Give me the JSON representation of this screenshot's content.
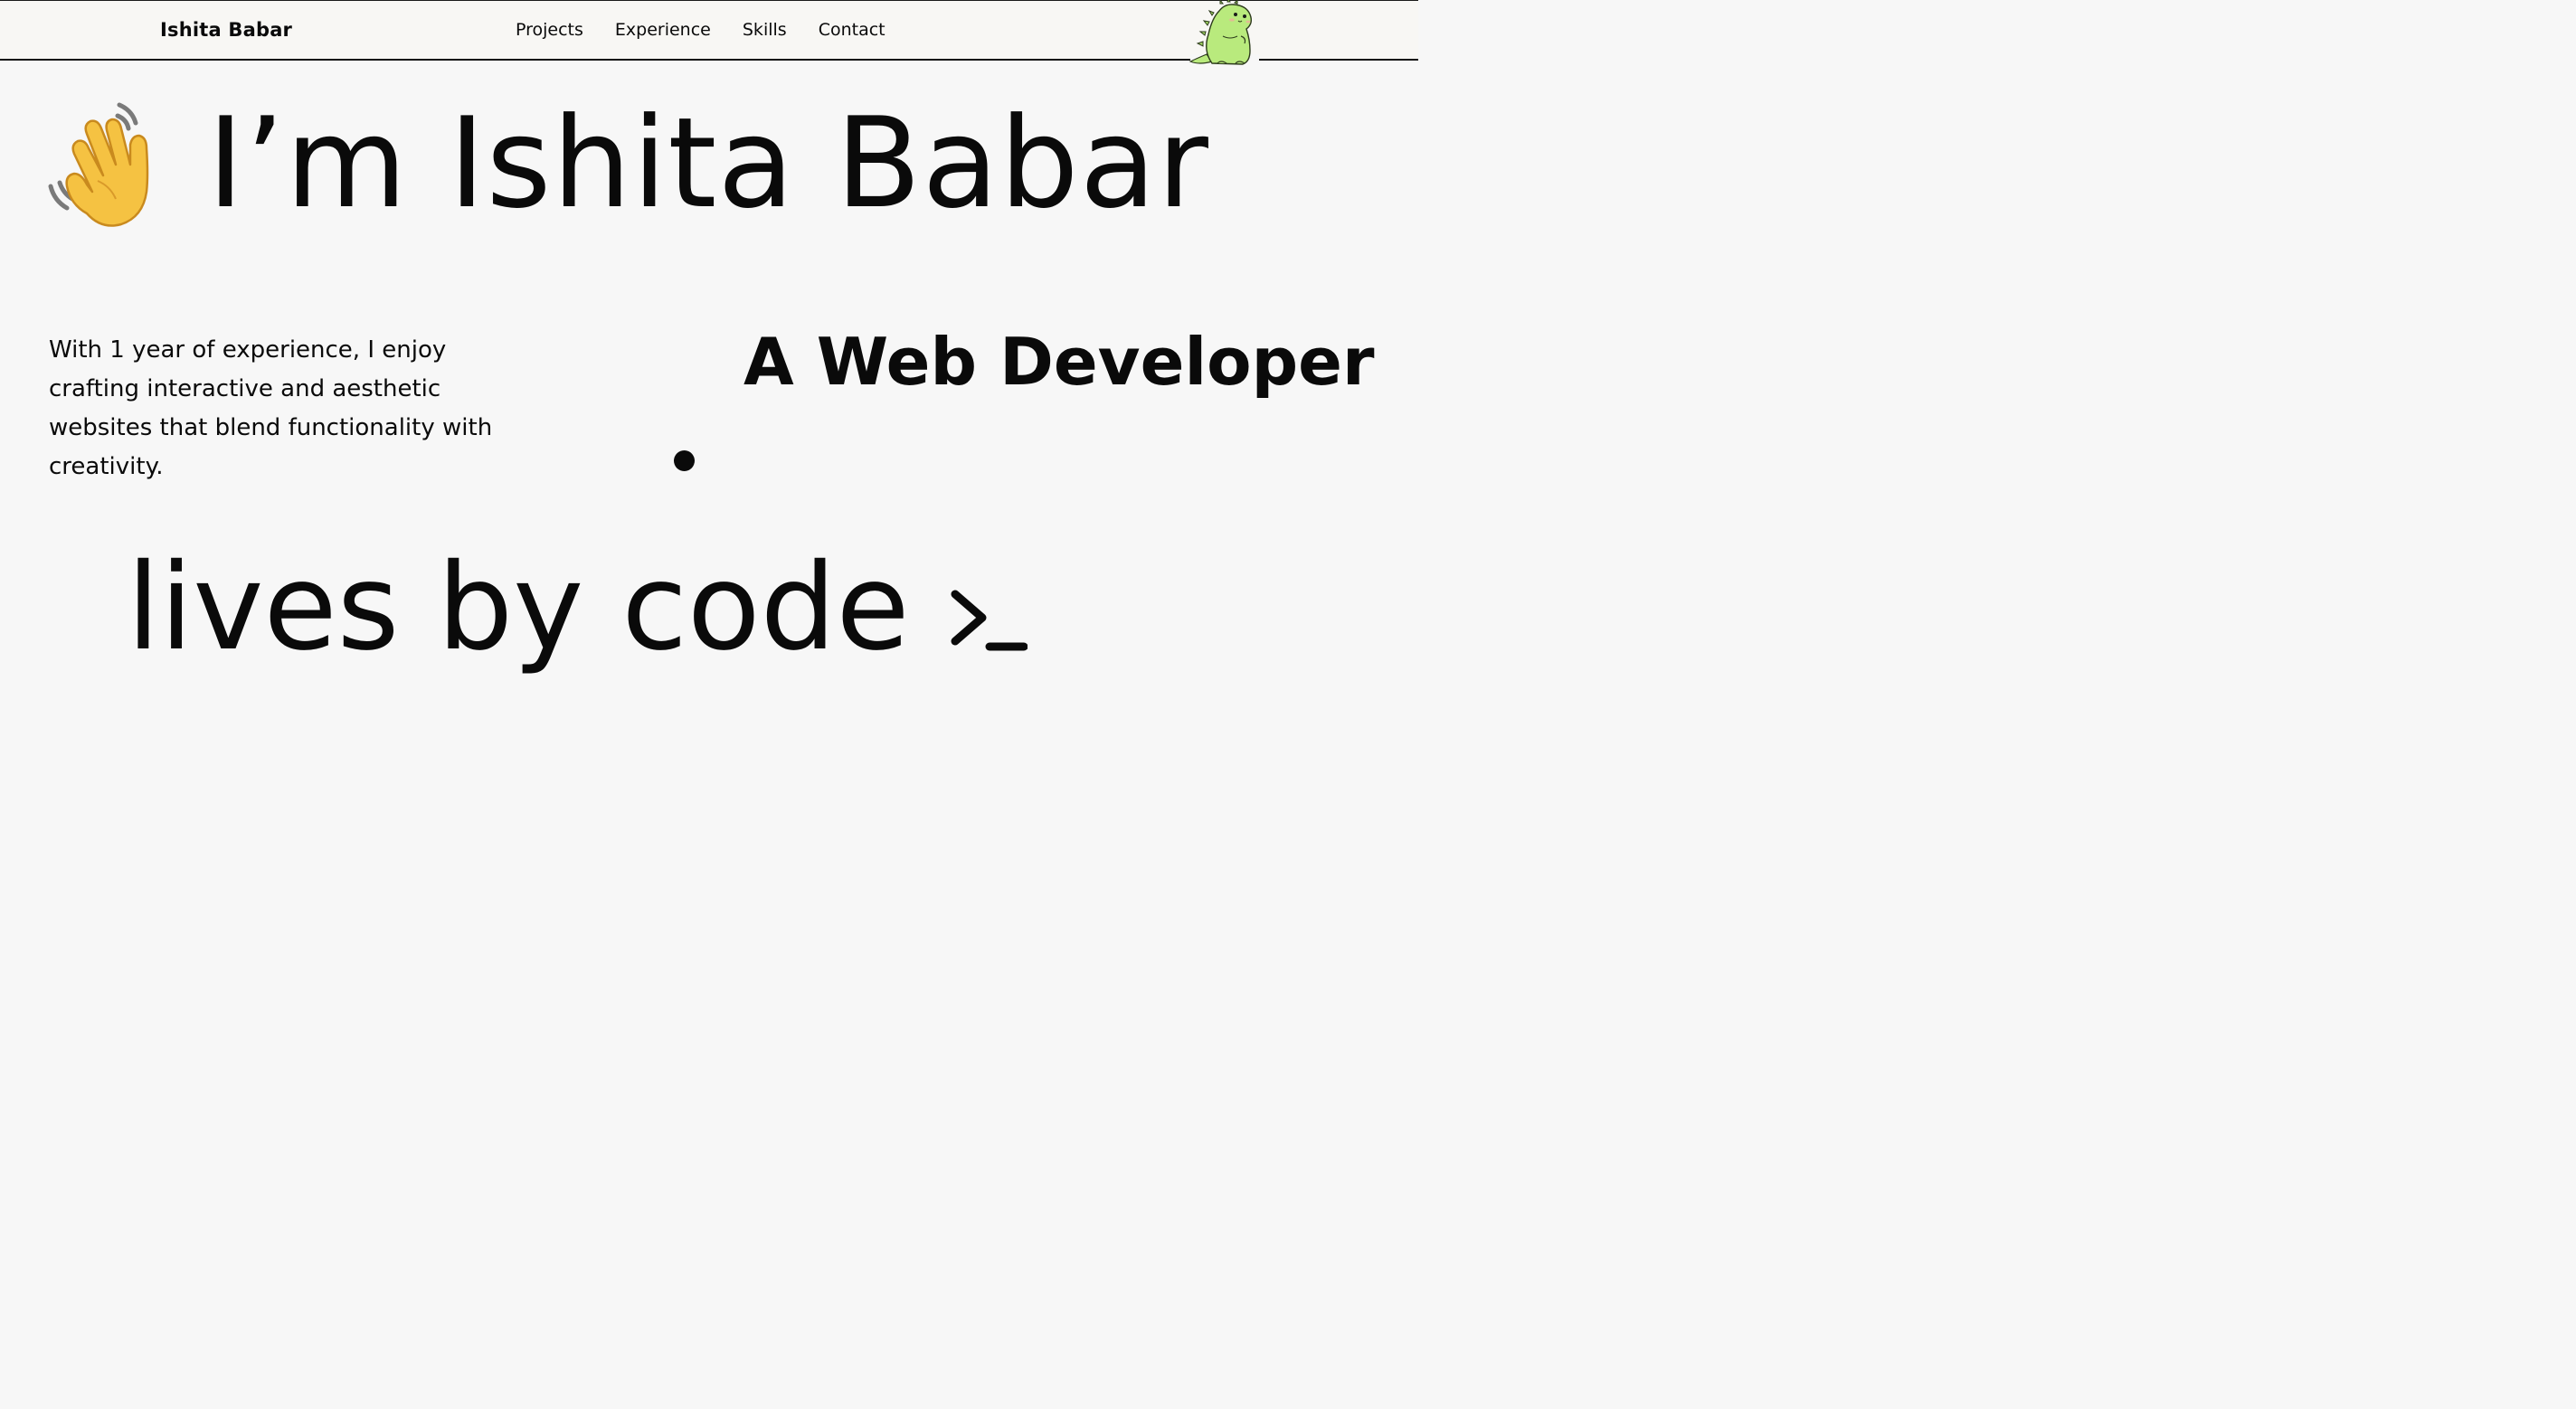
{
  "nav": {
    "brand": "Ishita Babar",
    "items": [
      {
        "label": "Projects"
      },
      {
        "label": "Experience"
      },
      {
        "label": "Skills"
      },
      {
        "label": "Contact"
      }
    ],
    "mascot_icon": "dinosaur-icon"
  },
  "hero": {
    "wave_icon": "waving-hand-icon",
    "title": "I’m Ishita Babar",
    "intro": "With 1 year of experience, I enjoy crafting interactive and aesthetic websites that blend functionality with creativity.",
    "role": "A Web Developer",
    "tagline": "lives by code",
    "prompt_icon": "terminal-prompt-icon"
  },
  "colors": {
    "background": "#f7f7f7",
    "nav_background": "#f8f7f4",
    "text": "#0a0a0a",
    "mascot_green": "#b9ea7d",
    "wave_yellow": "#f5c242"
  }
}
